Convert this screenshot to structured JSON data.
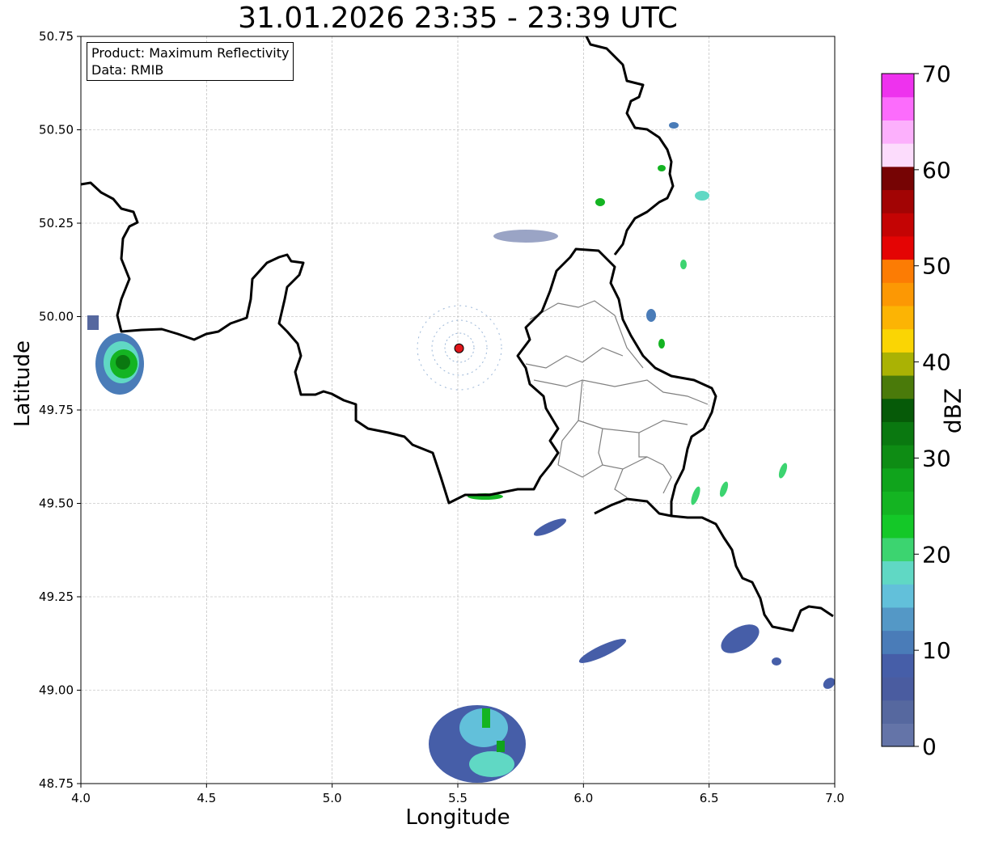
{
  "title": "31.01.2026 23:35 - 23:39 UTC",
  "info": {
    "product": "Product: Maximum Reflectivity",
    "source": "Data: RMIB"
  },
  "axes": {
    "xlabel": "Longitude",
    "ylabel": "Latitude",
    "xticks": [
      "4.0",
      "4.5",
      "5.0",
      "5.5",
      "6.0",
      "6.5",
      "7.0"
    ],
    "yticks": [
      "50.75",
      "50.50",
      "50.25",
      "50.00",
      "49.75",
      "49.50",
      "49.25",
      "49.00",
      "48.75"
    ],
    "xlim": [
      4.0,
      7.0
    ],
    "ylim": [
      48.75,
      50.75
    ],
    "grid": true
  },
  "radar_site": {
    "lon": 5.505,
    "lat": 49.915,
    "color": "#e0161b"
  },
  "colorbar": {
    "label": "dBZ",
    "ticks": [
      "0",
      "10",
      "20",
      "30",
      "40",
      "50",
      "60",
      "70"
    ],
    "min": 0,
    "max": 70,
    "colors": [
      "#6474a8",
      "#56689f",
      "#4a5ca0",
      "#465ea8",
      "#4a7cb8",
      "#5498c6",
      "#62c0da",
      "#60d8c4",
      "#3cd470",
      "#14c828",
      "#14b422",
      "#10a41c",
      "#0e8c14",
      "#0a7810",
      "#065a08",
      "#4a7a0a",
      "#aab204",
      "#fad504",
      "#fcb404",
      "#fc9804",
      "#fc7c04",
      "#e40404",
      "#c40404",
      "#a20404",
      "#760404",
      "#fcdcfc",
      "#fcb0fc",
      "#fc6cfc",
      "#ee32ee"
    ]
  },
  "legend_colors": {
    "border_country": "#000000",
    "border_province": "#808080"
  }
}
